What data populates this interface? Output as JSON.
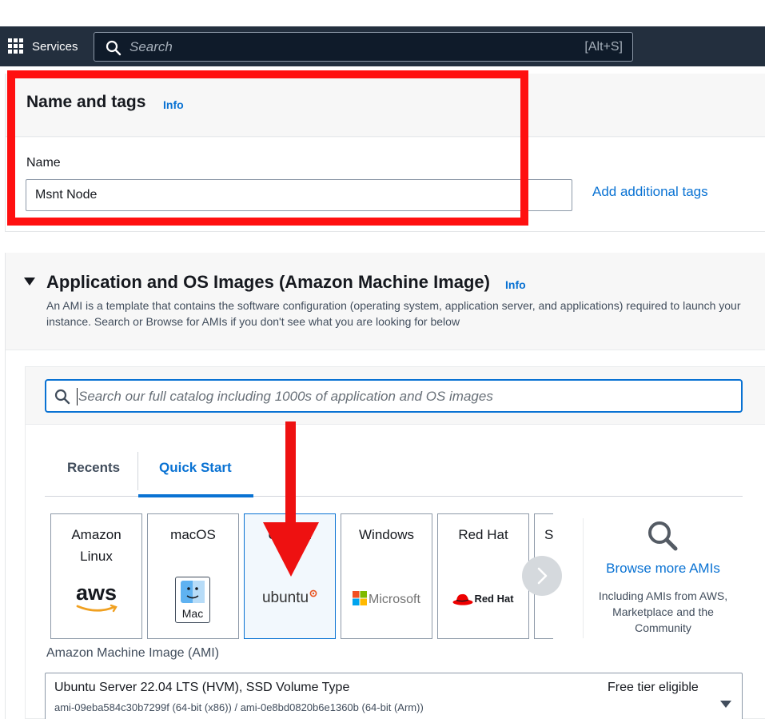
{
  "topbar": {
    "services_label": "Services",
    "search_placeholder": "Search",
    "search_shortcut": "[Alt+S]"
  },
  "name_and_tags": {
    "title": "Name and tags",
    "info_link": "Info",
    "name_label": "Name",
    "name_value": "Msnt Node",
    "add_tags_link": "Add additional tags"
  },
  "ami_section": {
    "title": "Application and OS Images (Amazon Machine Image)",
    "info_link": "Info",
    "description": "An AMI is a template that contains the software configuration (operating system, application server, and applications) required to launch your instance. Search or Browse for AMIs if you don't see what you are looking for below",
    "search_placeholder": "Search our full catalog including 1000s of application and OS images",
    "tabs": [
      {
        "label": "Recents",
        "selected": false
      },
      {
        "label": "Quick Start",
        "selected": true
      }
    ],
    "os_tiles": [
      {
        "label": "Amazon Linux",
        "logo_text": "aws",
        "icon": "aws-logo-icon",
        "selected": false
      },
      {
        "label": "macOS",
        "logo_text": "Mac",
        "icon": "finder-mac-icon",
        "selected": false
      },
      {
        "label": "Ubuntu",
        "logo_text": "ubuntu",
        "icon": "ubuntu-logo-icon",
        "selected": true
      },
      {
        "label": "Windows",
        "logo_text": "Microsoft",
        "icon": "microsoft-logo-icon",
        "selected": false
      },
      {
        "label": "Red Hat",
        "logo_text": "Red Hat",
        "icon": "redhat-hat-icon",
        "selected": false
      },
      {
        "label": "S",
        "selected": false
      }
    ],
    "browse": {
      "title": "Browse more AMIs",
      "description": "Including AMIs from AWS, Marketplace and the Community"
    },
    "ami_label": "Amazon Machine Image (AMI)",
    "selected_ami": {
      "name": "Ubuntu Server 22.04 LTS (HVM), SSD Volume Type",
      "ids": "ami-09eba584c30b7299f (64-bit (x86)) / ami-0e8bd0820b6e1360b (64-bit (Arm))",
      "badge": "Free tier eligible"
    }
  },
  "colors": {
    "nav_bg": "#232f3e",
    "link": "#0972d3",
    "annotation_red": "#ff1010"
  }
}
